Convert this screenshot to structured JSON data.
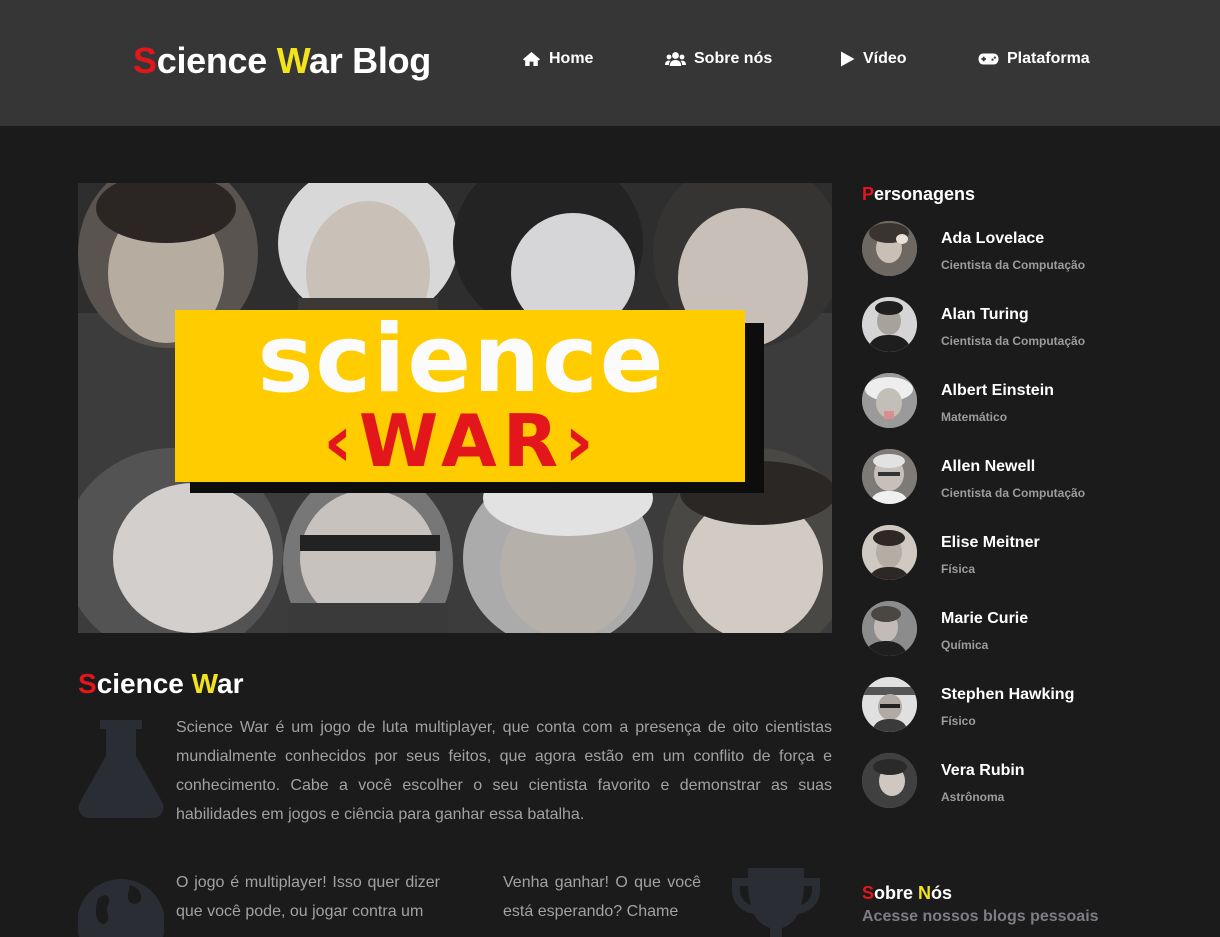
{
  "brand": {
    "part1": "S",
    "part2": "cience ",
    "part3": "W",
    "part4": "ar Blog"
  },
  "nav": [
    {
      "label": "Home",
      "icon": "home-icon"
    },
    {
      "label": "Sobre nós",
      "icon": "users-icon"
    },
    {
      "label": "Vídeo",
      "icon": "play-icon"
    },
    {
      "label": "Plataforma",
      "icon": "gamepad-icon"
    }
  ],
  "hero": {
    "line1": "science",
    "line2": "‹WAR›"
  },
  "article": {
    "title_p1": "S",
    "title_p2": "cience ",
    "title_p3": "W",
    "title_p4": "ar",
    "paragraph1": "Science War é um jogo de luta multiplayer, que conta com a presença de oito cientistas mundialmente conhecidos por seus feitos, que agora estão em um conflito de força e conhecimento. Cabe a você escolher o seu cientista favorito e demonstrar as suas habilidades em jogos e ciência para ganhar essa batalha.",
    "paragraph2": "O jogo é multiplayer! Isso quer dizer que você pode, ou jogar contra um",
    "paragraph3": "Venha ganhar! O que você está esperando? Chame"
  },
  "sidebar": {
    "characters_title_p1": "P",
    "characters_title_p2": "ersonagens",
    "characters": [
      {
        "name": "Ada Lovelace",
        "role": "Cientista da Computação"
      },
      {
        "name": "Alan Turing",
        "role": "Cientista da Computação"
      },
      {
        "name": "Albert Einstein",
        "role": "Matemático"
      },
      {
        "name": "Allen Newell",
        "role": "Cientista da Computação"
      },
      {
        "name": "Elise Meitner",
        "role": "Física"
      },
      {
        "name": "Marie Curie",
        "role": "Química"
      },
      {
        "name": "Stephen Hawking",
        "role": "Físico"
      },
      {
        "name": "Vera Rubin",
        "role": "Astrônoma"
      }
    ],
    "about_title_p1": "S",
    "about_title_p2": "obre ",
    "about_title_p3": "N",
    "about_title_p4": "ós",
    "about_subtitle": "Acesse nossos blogs pessoais"
  },
  "colors": {
    "accent_red": "#e3161b",
    "accent_yellow": "#f2e31c",
    "header_bg": "#363636",
    "page_bg": "#1b1b1c"
  }
}
